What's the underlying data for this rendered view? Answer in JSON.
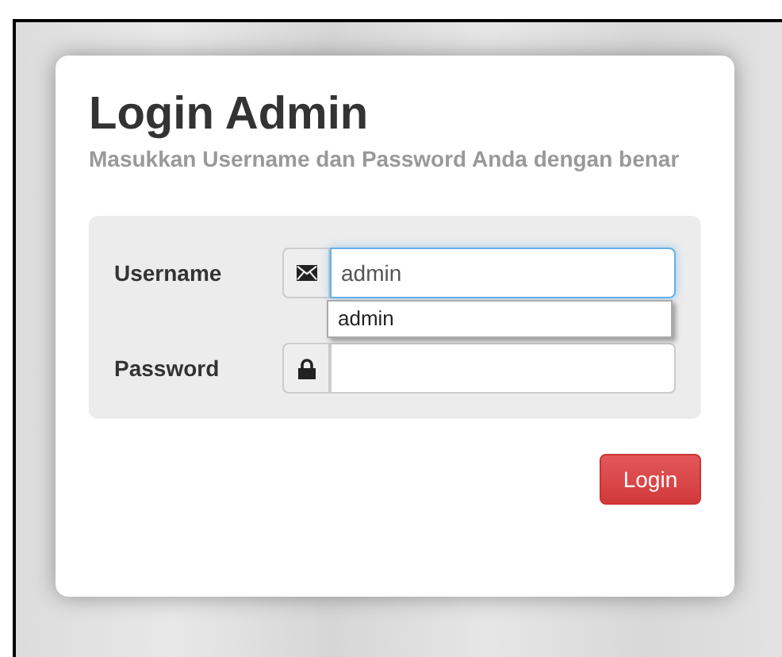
{
  "title": "Login Admin",
  "subtitle": "Masukkan Username dan Password Anda dengan benar",
  "fields": [
    {
      "label": "Username",
      "kind": "text",
      "value": "admin",
      "focused": true,
      "suggestions": [
        "admin"
      ]
    },
    {
      "label": "Password",
      "kind": "password",
      "focused": false
    }
  ],
  "button": "Login"
}
